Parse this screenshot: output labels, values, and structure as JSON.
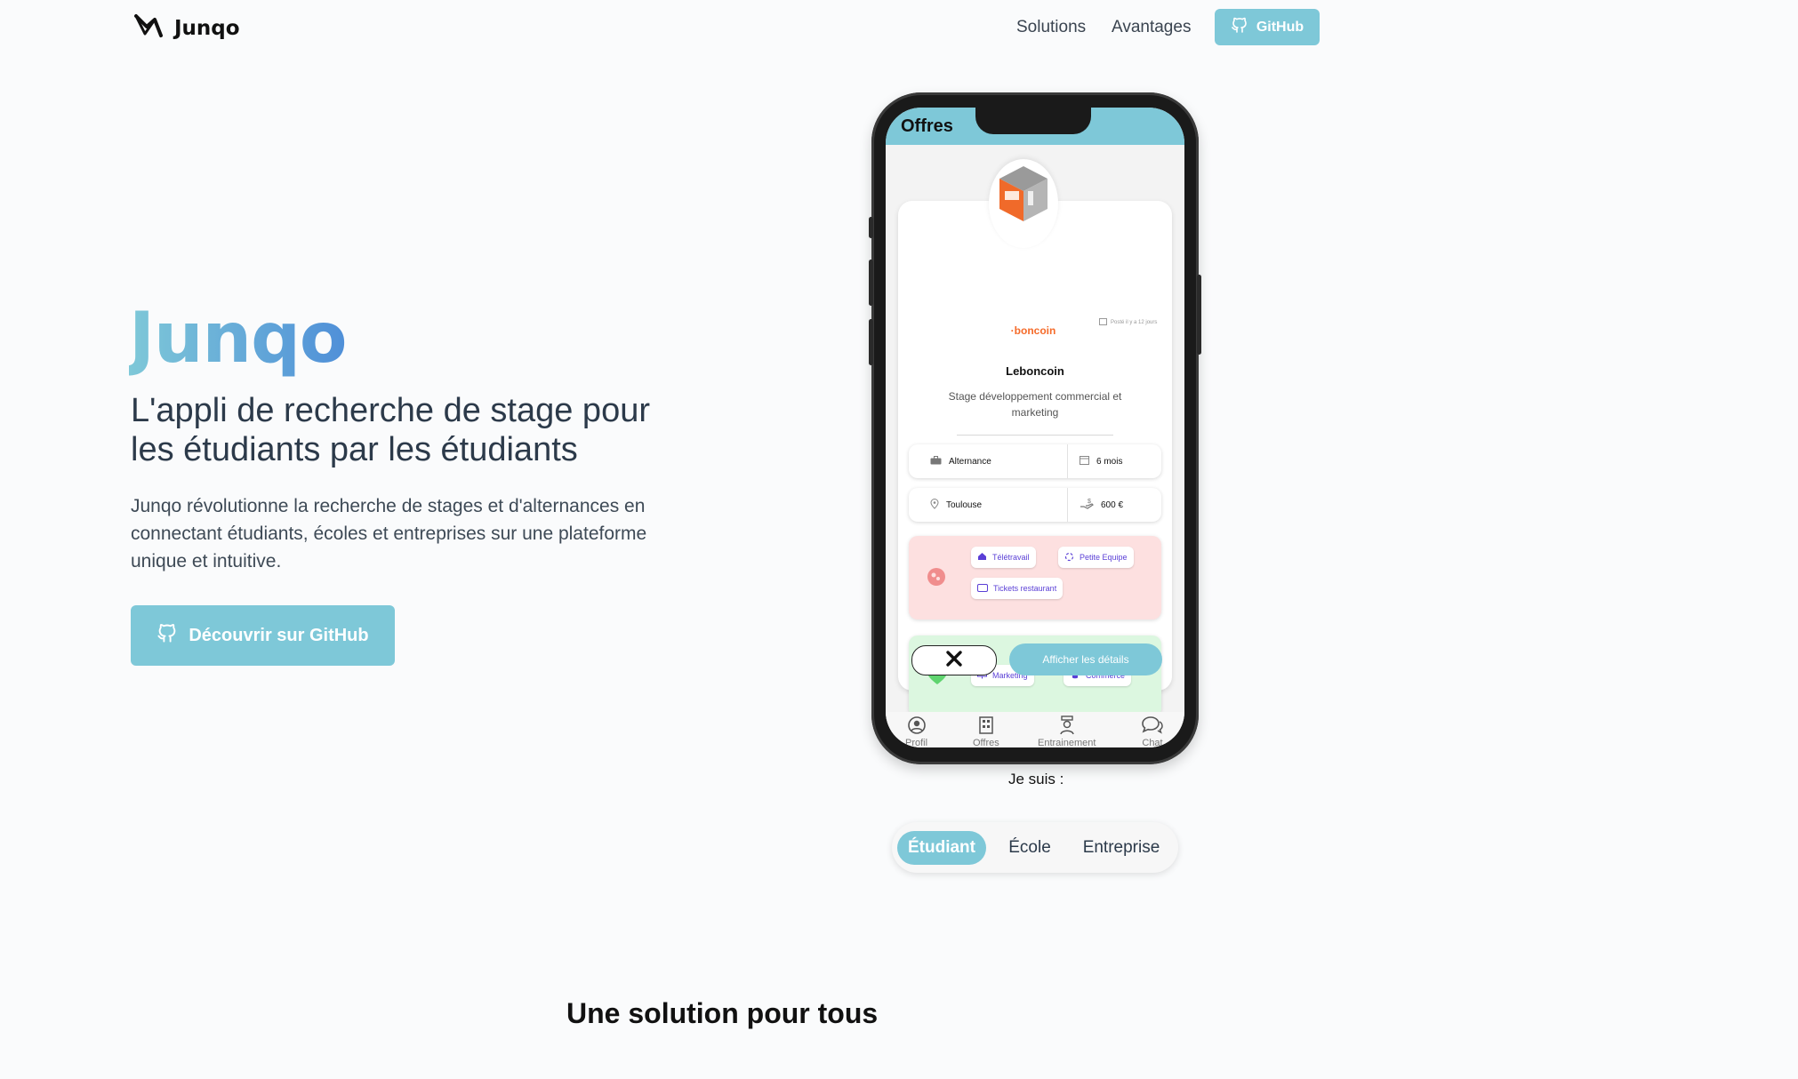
{
  "nav": {
    "brand": "Junqo",
    "links": [
      "Solutions",
      "Avantages"
    ],
    "github_label": "GitHub"
  },
  "hero": {
    "title": "Junqo",
    "subtitle": "L'appli de recherche de stage pour les étudiants par les étudiants",
    "description": "Junqo révolutionne la recherche de stages et d'alternances en connectant étudiants, écoles et entreprises sur une plateforme unique et intuitive.",
    "cta_label": "Découvrir sur GitHub"
  },
  "phone": {
    "screen_title": "Offres",
    "offer": {
      "logo_text": "·boncoin",
      "posted": "Posté il y a 12 jours",
      "company": "Leboncoin",
      "job_title": "Stage développement commercial et marketing",
      "contract": "Alternance",
      "duration": "6 mois",
      "location": "Toulouse",
      "salary": "600 €",
      "perks": [
        "Télétravail",
        "Petite Equipe",
        "Tickets restaurant"
      ],
      "skills": [
        "Marketing",
        "Commerce"
      ]
    },
    "detail_button": "Afficher les détails",
    "tabs": [
      "Profil",
      "Offres",
      "Entrainement",
      "Chat"
    ]
  },
  "selector": {
    "label": "Je suis :",
    "options": [
      "Étudiant",
      "École",
      "Entreprise"
    ],
    "active": "Étudiant"
  },
  "section": {
    "title": "Une solution pour tous"
  },
  "colors": {
    "accent": "#7ec8d8",
    "gradient_end": "#4f8fd8",
    "perk_bg": "#fde0e0",
    "skill_bg": "#dcf7e0",
    "chip_text": "#5a3fd6"
  }
}
